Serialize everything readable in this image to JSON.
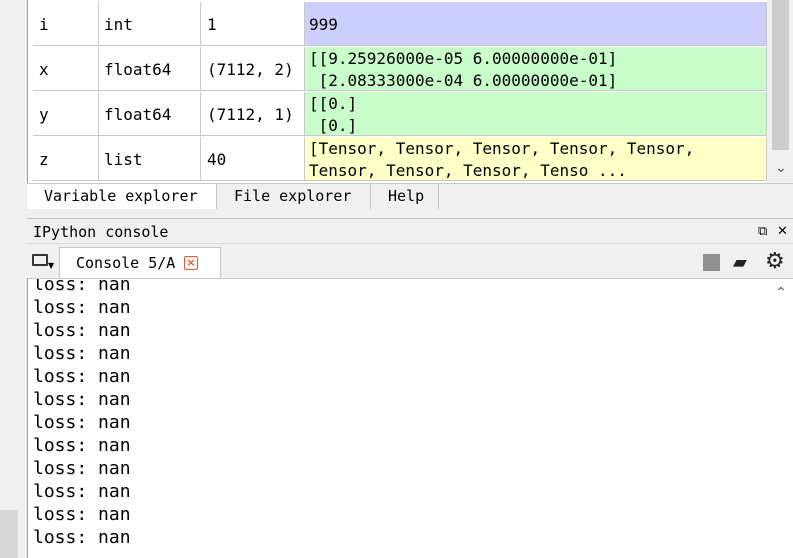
{
  "variable_explorer": {
    "rows": [
      {
        "name": "i",
        "type": "int",
        "size": "1",
        "value": "999",
        "color": "#cccffd"
      },
      {
        "name": "x",
        "type": "float64",
        "size": "(7112, 2)",
        "value": "[[9.25926000e-05 6.00000000e-01]\n [2.08333000e-04 6.00000000e-01]",
        "color": "#c8fcc8"
      },
      {
        "name": "y",
        "type": "float64",
        "size": "(7112, 1)",
        "value": "[[0.]\n [0.]",
        "color": "#c8fcc8"
      },
      {
        "name": "z",
        "type": "list",
        "size": "40",
        "value": "[Tensor, Tensor, Tensor, Tensor, Tensor,\nTensor, Tensor, Tensor, Tenso ...",
        "color": "#ffffc8"
      }
    ]
  },
  "explorer_tabs": [
    {
      "label": "Variable explorer",
      "active": true
    },
    {
      "label": "File explorer",
      "active": false
    },
    {
      "label": "Help",
      "active": false
    }
  ],
  "console": {
    "title": "IPython console",
    "header_icons": [
      "undock-icon",
      "close-icon"
    ],
    "tab_label": "Console 5/A",
    "tab_close": "×",
    "toolbar_icons": [
      "stop-icon",
      "eraser-icon",
      "gear-icon"
    ],
    "lines": [
      "loss: nan",
      "loss: nan",
      "loss: nan",
      "loss: nan",
      "loss: nan",
      "loss: nan",
      "loss: nan",
      "loss: nan",
      "loss: nan",
      "loss: nan",
      "loss: nan",
      "loss: nan"
    ]
  }
}
